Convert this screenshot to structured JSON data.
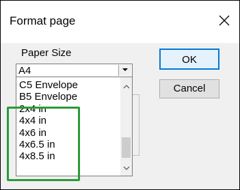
{
  "window": {
    "title": "Format page"
  },
  "paper_size": {
    "label": "Paper Size",
    "selected": "A4",
    "options": [
      "C5 Envelope",
      "B5 Envelope",
      "2x4 in",
      "4x4 in",
      "4x6 in",
      "4x6.5 in",
      "4x8.5 in"
    ]
  },
  "buttons": {
    "ok": "OK",
    "cancel": "Cancel"
  },
  "colors": {
    "highlight": "#2a9a37",
    "ok_border": "#0078d7"
  },
  "icons": {
    "close": "close-icon",
    "dropdown": "chevron-down-icon",
    "scroll_up": "chevron-up-icon",
    "scroll_down": "chevron-down-icon"
  }
}
